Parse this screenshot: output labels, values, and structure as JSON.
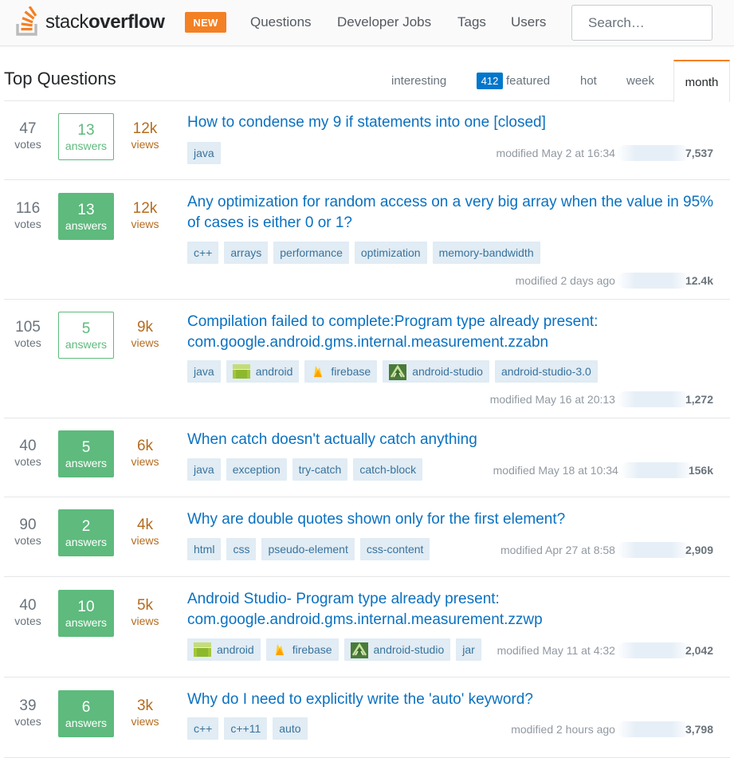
{
  "topbar": {
    "logo": {
      "text_light": "stack",
      "text_bold": "overflow",
      "icon": "stackoverflow-logo-icon"
    },
    "new_badge": "NEW",
    "nav": [
      "Questions",
      "Developer Jobs",
      "Tags",
      "Users"
    ],
    "search_placeholder": "Search…"
  },
  "header": {
    "title": "Top Questions",
    "tabs": [
      {
        "label": "interesting"
      },
      {
        "badge": "412",
        "label": "featured"
      },
      {
        "label": "hot"
      },
      {
        "label": "week"
      },
      {
        "label": "month",
        "active": true
      }
    ]
  },
  "colors": {
    "brand_orange": "#f48024",
    "accepted_green": "#5eba7d",
    "link_blue": "#0a71c1",
    "tag_bg": "#e1ecf4",
    "tag_text": "#39739d",
    "views_orange": "#b56c1f"
  },
  "questions": [
    {
      "votes": "47",
      "votes_label": "votes",
      "answers": "13",
      "answers_label": "answers",
      "accepted": false,
      "views": "12k",
      "views_label": "views",
      "title": "How to condense my 9 if statements into one [closed]",
      "tags": [
        "java"
      ],
      "modified": "modified May 2 at 16:34",
      "rep": "7,537"
    },
    {
      "votes": "116",
      "votes_label": "votes",
      "answers": "13",
      "answers_label": "answers",
      "accepted": true,
      "views": "12k",
      "views_label": "views",
      "title": "Any optimization for random access on a very big array when the value in 95% of cases is either 0 or 1?",
      "tags": [
        "c++",
        "arrays",
        "performance",
        "optimization",
        "memory-bandwidth"
      ],
      "modified": "modified 2 days ago",
      "rep": "12.4k"
    },
    {
      "votes": "105",
      "votes_label": "votes",
      "answers": "5",
      "answers_label": "answers",
      "accepted": false,
      "views": "9k",
      "views_label": "views",
      "title": "Compilation failed to complete:Program type already present: com.google.android.gms.internal.measurement.zzabn",
      "tags": [
        "java",
        "android",
        "firebase",
        "android-studio",
        "android-studio-3.0"
      ],
      "tag_icons": [
        "",
        "android-icon",
        "firebase-icon",
        "android-studio-icon",
        ""
      ],
      "modified": "modified May 16 at 20:13",
      "rep": "1,272"
    },
    {
      "votes": "40",
      "votes_label": "votes",
      "answers": "5",
      "answers_label": "answers",
      "accepted": true,
      "views": "6k",
      "views_label": "views",
      "title": "When catch doesn't actually catch anything",
      "tags": [
        "java",
        "exception",
        "try-catch",
        "catch-block"
      ],
      "modified": "modified May 18 at 10:34",
      "rep": "156k"
    },
    {
      "votes": "90",
      "votes_label": "votes",
      "answers": "2",
      "answers_label": "answers",
      "accepted": true,
      "views": "4k",
      "views_label": "views",
      "title": "Why are double quotes shown only for the first element?",
      "tags": [
        "html",
        "css",
        "pseudo-element",
        "css-content"
      ],
      "modified": "modified Apr 27 at 8:58",
      "rep": "2,909"
    },
    {
      "votes": "40",
      "votes_label": "votes",
      "answers": "10",
      "answers_label": "answers",
      "accepted": true,
      "views": "5k",
      "views_label": "views",
      "title": "Android Studio- Program type already present: com.google.android.gms.internal.measurement.zzwp",
      "tags": [
        "android",
        "firebase",
        "android-studio",
        "jar"
      ],
      "tag_icons": [
        "android-icon",
        "firebase-icon",
        "android-studio-icon",
        ""
      ],
      "modified": "modified May 11 at 4:32",
      "rep": "2,042"
    },
    {
      "votes": "39",
      "votes_label": "votes",
      "answers": "6",
      "answers_label": "answers",
      "accepted": true,
      "views": "3k",
      "views_label": "views",
      "title": "Why do I need to explicitly write the 'auto' keyword?",
      "tags": [
        "c++",
        "c++11",
        "auto"
      ],
      "modified": "modified 2 hours ago",
      "rep": "3,798"
    }
  ]
}
